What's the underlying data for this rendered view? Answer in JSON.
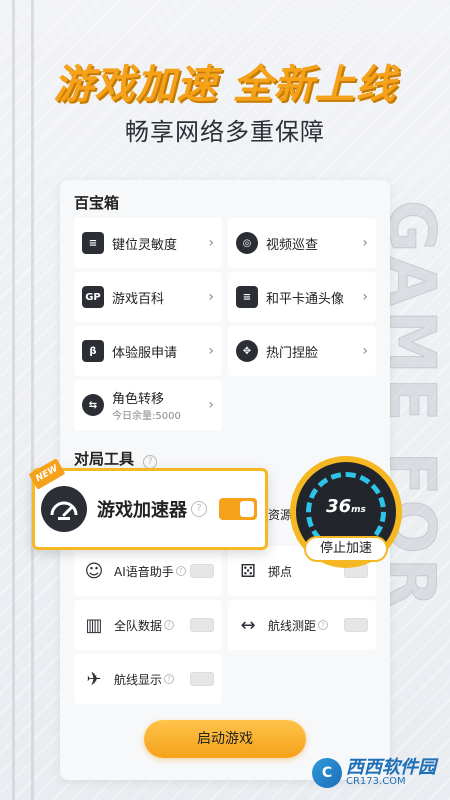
{
  "headline": "游戏加速 全新上线",
  "subline": "畅享网络多重保障",
  "bg_text": "GAME FOR PEACE",
  "toolbox": {
    "title": "百宝箱",
    "items": [
      {
        "label": "键位灵敏度",
        "icon": "sliders-icon",
        "glyph": "≡"
      },
      {
        "label": "视频巡查",
        "icon": "camera-icon",
        "glyph": "◎"
      },
      {
        "label": "游戏百科",
        "icon": "gp-icon",
        "glyph": "GP"
      },
      {
        "label": "和平卡通头像",
        "icon": "sliders-icon",
        "glyph": "≡"
      },
      {
        "label": "体验服申请",
        "icon": "beta-icon",
        "glyph": "β"
      },
      {
        "label": "热门捏脸",
        "icon": "face-icon",
        "glyph": "✥"
      },
      {
        "label": "角色转移",
        "sub": "今日余量:5000",
        "icon": "role-transfer-icon",
        "glyph": "⇆"
      }
    ]
  },
  "match_tools": {
    "title": "对局工具",
    "items": [
      {
        "label": "AI语音助手",
        "icon": "ai-voice-icon",
        "glyph": "☺"
      },
      {
        "label": "掷点",
        "icon": "dice-icon",
        "glyph": "⚄"
      },
      {
        "label": "全队数据",
        "icon": "team-data-icon",
        "glyph": "▥"
      },
      {
        "label": "航线测距",
        "icon": "distance-icon",
        "glyph": "↔"
      },
      {
        "label": "航线显示",
        "icon": "airplane-icon",
        "glyph": "✈"
      }
    ],
    "partial_label": "资源"
  },
  "accelerator": {
    "new_tag": "NEW",
    "label": "游戏加速器",
    "speed": "36",
    "speed_unit": "ms",
    "stop_label": "停止加速"
  },
  "start_button": "启动游戏",
  "watermark": {
    "name": "西西软件园",
    "sub": "CR173.COM"
  },
  "colors": {
    "accent": "#f5a11a",
    "ring": "#2ec4e8",
    "dark": "#2b2e35"
  }
}
